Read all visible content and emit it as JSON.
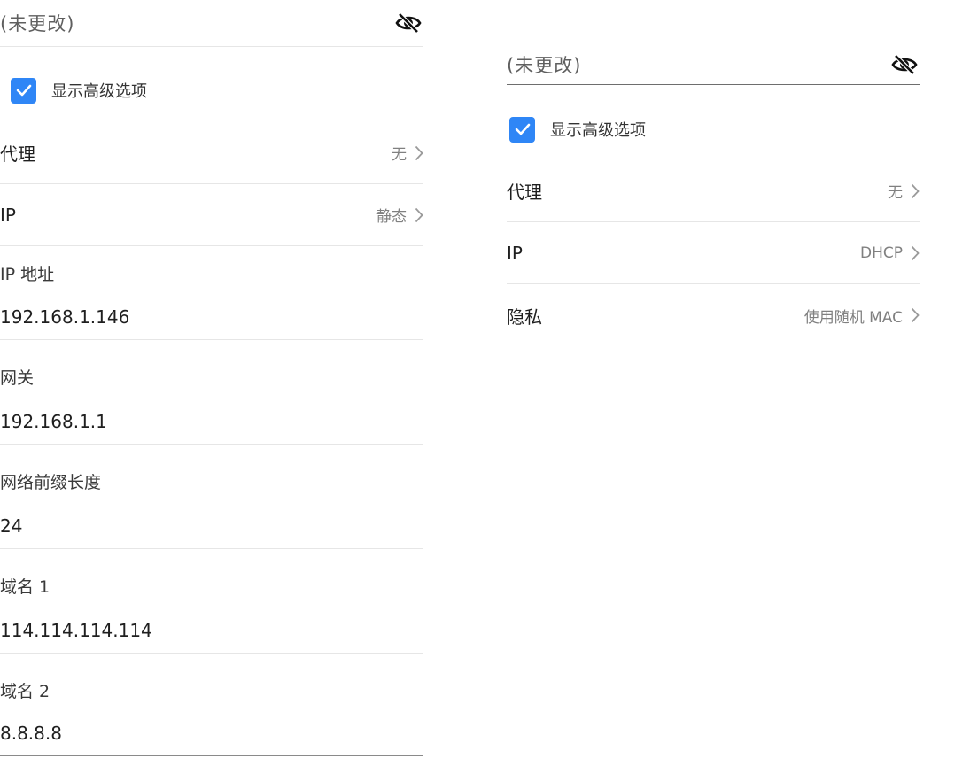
{
  "left": {
    "password": {
      "value": "(未更改)",
      "visibility_icon": "eye-off-icon"
    },
    "advanced": {
      "label": "显示高级选项",
      "checked": true
    },
    "proxy": {
      "label": "代理",
      "value": "无"
    },
    "ip": {
      "label": "IP",
      "value": "静态"
    },
    "ip_address": {
      "label": "IP 地址",
      "value": "192.168.1.146"
    },
    "gateway": {
      "label": "网关",
      "value": "192.168.1.1"
    },
    "prefix_length": {
      "label": "网络前缀长度",
      "value": "24"
    },
    "dns1": {
      "label": "域名 1",
      "value": "114.114.114.114"
    },
    "dns2": {
      "label": "域名 2",
      "value": "8.8.8.8"
    }
  },
  "right": {
    "password": {
      "value": "(未更改)",
      "visibility_icon": "eye-off-icon"
    },
    "advanced": {
      "label": "显示高级选项",
      "checked": true
    },
    "proxy": {
      "label": "代理",
      "value": "无"
    },
    "ip": {
      "label": "IP",
      "value": "DHCP"
    },
    "privacy": {
      "label": "隐私",
      "value": "使用随机 MAC"
    }
  },
  "colors": {
    "accent": "#2f86f6",
    "divider": "#e6e6e6",
    "secondary_text": "#808080"
  }
}
